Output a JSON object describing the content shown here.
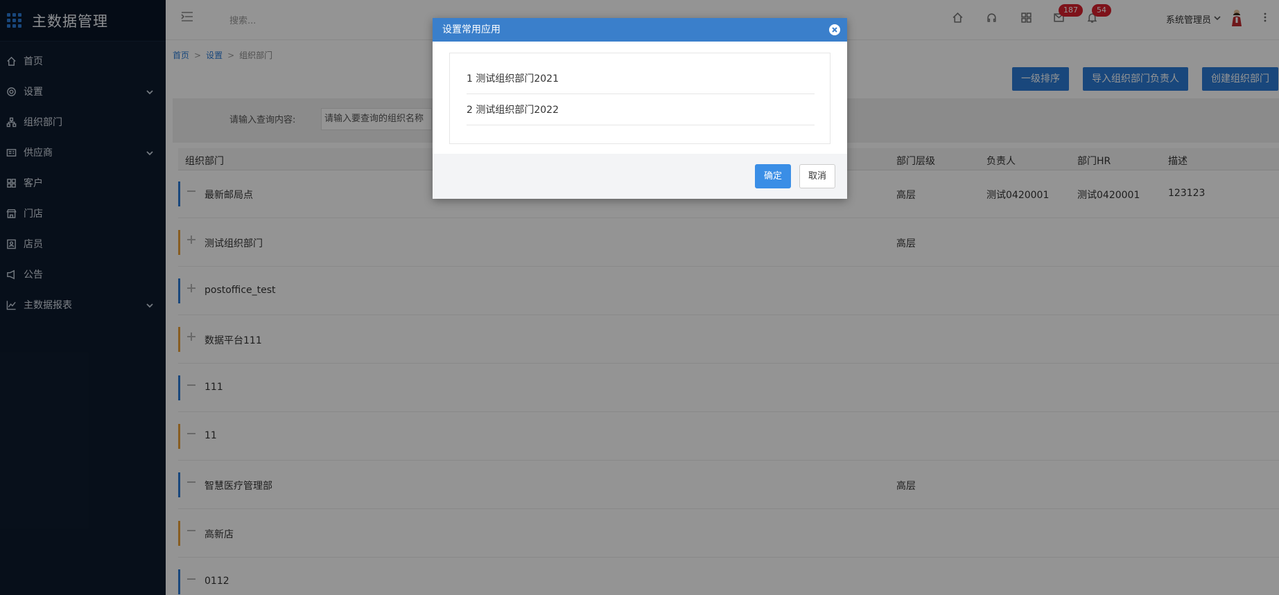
{
  "app": {
    "title": "主数据管理"
  },
  "sidebar": {
    "items": [
      {
        "label": "首页",
        "icon": "home-icon",
        "has_submenu": false
      },
      {
        "label": "设置",
        "icon": "gear-icon",
        "has_submenu": true
      },
      {
        "label": "组织部门",
        "icon": "org-tree-icon",
        "has_submenu": false
      },
      {
        "label": "供应商",
        "icon": "supplier-icon",
        "has_submenu": true
      },
      {
        "label": "客户",
        "icon": "customer-icon",
        "has_submenu": false
      },
      {
        "label": "门店",
        "icon": "store-icon",
        "has_submenu": false
      },
      {
        "label": "店员",
        "icon": "clerk-icon",
        "has_submenu": false
      },
      {
        "label": "公告",
        "icon": "announcement-icon",
        "has_submenu": false
      },
      {
        "label": "主数据报表",
        "icon": "chart-icon",
        "has_submenu": true
      }
    ]
  },
  "topbar": {
    "search_placeholder": "搜索...",
    "badges": {
      "messages": "187",
      "notifications": "54"
    },
    "user_name": "系统管理员"
  },
  "breadcrumb": {
    "home": "首页",
    "settings": "设置",
    "current": "组织部门",
    "sep": ">"
  },
  "actions": {
    "sort": "一级排序",
    "import": "导入组织部门负责人",
    "create": "创建组织部门"
  },
  "search": {
    "label": "请输入查询内容:",
    "placeholder": "请输入要查询的组织名称"
  },
  "table": {
    "headers": {
      "name": "组织部门",
      "level": "部门层级",
      "owner": "负责人",
      "hr": "部门HR",
      "desc": "描述"
    },
    "rows": [
      {
        "name": "最新邮局点",
        "level": "高层",
        "owner": "测试0420001",
        "hr": "测试0420001",
        "desc": "123123",
        "expanded": true,
        "color": "#2b7bd6"
      },
      {
        "name": "测试组织部门",
        "level": "高层",
        "owner": "",
        "hr": "",
        "desc": "",
        "expanded": false,
        "color": "#e8a13a"
      },
      {
        "name": "postoffice_test",
        "level": "",
        "owner": "",
        "hr": "",
        "desc": "",
        "expanded": false,
        "color": "#2b7bd6"
      },
      {
        "name": "数据平台111",
        "level": "",
        "owner": "",
        "hr": "",
        "desc": "",
        "expanded": false,
        "color": "#e8a13a"
      },
      {
        "name": "111",
        "level": "",
        "owner": "",
        "hr": "",
        "desc": "",
        "expanded": true,
        "color": "#2b7bd6"
      },
      {
        "name": "11",
        "level": "",
        "owner": "",
        "hr": "",
        "desc": "",
        "expanded": true,
        "color": "#e8a13a"
      },
      {
        "name": "智慧医疗管理部",
        "level": "高层",
        "owner": "",
        "hr": "",
        "desc": "",
        "expanded": true,
        "color": "#2b7bd6"
      },
      {
        "name": "高新店",
        "level": "",
        "owner": "",
        "hr": "",
        "desc": "",
        "expanded": true,
        "color": "#e8a13a"
      },
      {
        "name": "0112",
        "level": "",
        "owner": "",
        "hr": "",
        "desc": "",
        "expanded": true,
        "color": "#2b7bd6"
      }
    ]
  },
  "modal": {
    "title": "设置常用应用",
    "items": [
      "1 测试组织部门2021",
      "2 测试组织部门2022"
    ],
    "confirm": "确定",
    "cancel": "取消"
  },
  "colors": {
    "accent": "#2b7bd6",
    "sidebar_bg": "#0d1b2e",
    "badge": "#d9202d",
    "modal_header": "#3a7fcb"
  }
}
